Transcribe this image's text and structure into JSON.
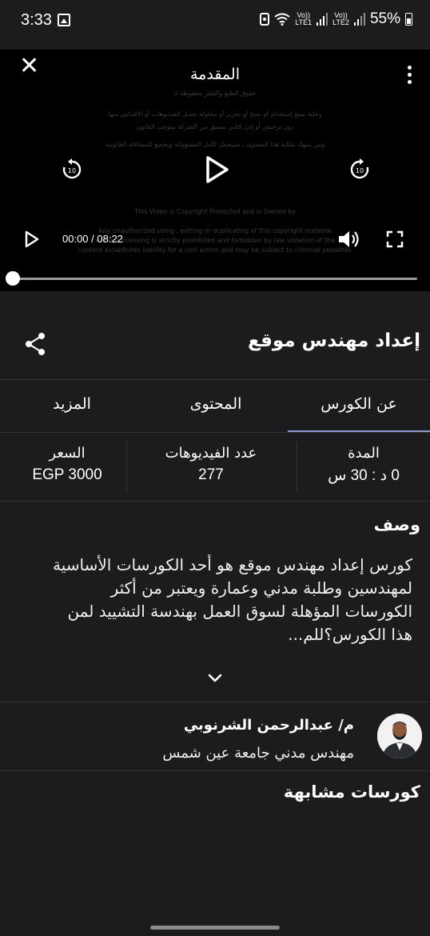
{
  "status_bar": {
    "time": "3:33",
    "sim1": "Vo)) LTE1",
    "sim1_top": "Vo))",
    "sim1_bottom": "LTE1",
    "sim2_top": "Vo))",
    "sim2_bottom": "LTE2",
    "battery": "55%"
  },
  "player": {
    "title": "المقدمة",
    "current_time": "00:00",
    "duration": "08:22",
    "time_display": "00:00 / 08:22",
    "progress_fraction": 0.0,
    "rewind_seconds": "10",
    "forward_seconds": "10",
    "watermark_lines": [
      "حقوق الطبع والنشر محفوظة لـ",
      "وعليه يمنع إستخدام أو نسخ أو تحرير أو محاولة تعديل الفيديوهات أو الاقتباس منها",
      "دون ترخيص أو إذن كتابي مسبق من الشركة بموجب القانون",
      "ومن ينتهك ملكية هذا المحتوى ، سيتحمل كامل المسؤولية ويخضع للمساءلة القانونية",
      "This Video is Copyright Protected and is Owned by",
      "Any unauthorized using , editing or duplicating of this copyright material",
      "without licensing is strictly prohibited and forbidden by law violation of the",
      "content establishes liability for a civil action and may be subject to criminal penalties"
    ]
  },
  "course": {
    "title": "إعداد مهندس موقع"
  },
  "tabs": [
    {
      "label": "عن الكورس",
      "active": true
    },
    {
      "label": "المحتوى",
      "active": false
    },
    {
      "label": "المزيد",
      "active": false
    }
  ],
  "stats": {
    "duration_label": "المدة",
    "duration_value": "0 د : 30 س",
    "videos_label": "عدد الفيديوهات",
    "videos_value": "277",
    "price_label": "السعر",
    "price_value": "EGP 3000"
  },
  "description": {
    "title": "وصف",
    "text": "كورس إعداد مهندس موقع هو أحد الكورسات الأساسية لمهندسين وطلبة مدني وعمارة ويعتبر من أكثر الكورسات المؤهلة لسوق العمل بهندسة التشييد لمن هذا الكورس؟للم..."
  },
  "instructor": {
    "name": "م/ عبدالرحمن الشرنوبي",
    "role": "مهندس مدني جامعة عين شمس"
  },
  "similar": {
    "title": "كورسات مشابهة"
  },
  "colors": {
    "background": "#1c1c1e",
    "video_background": "#000000",
    "tab_indicator": "#8f99cf",
    "divider": "#333336"
  }
}
